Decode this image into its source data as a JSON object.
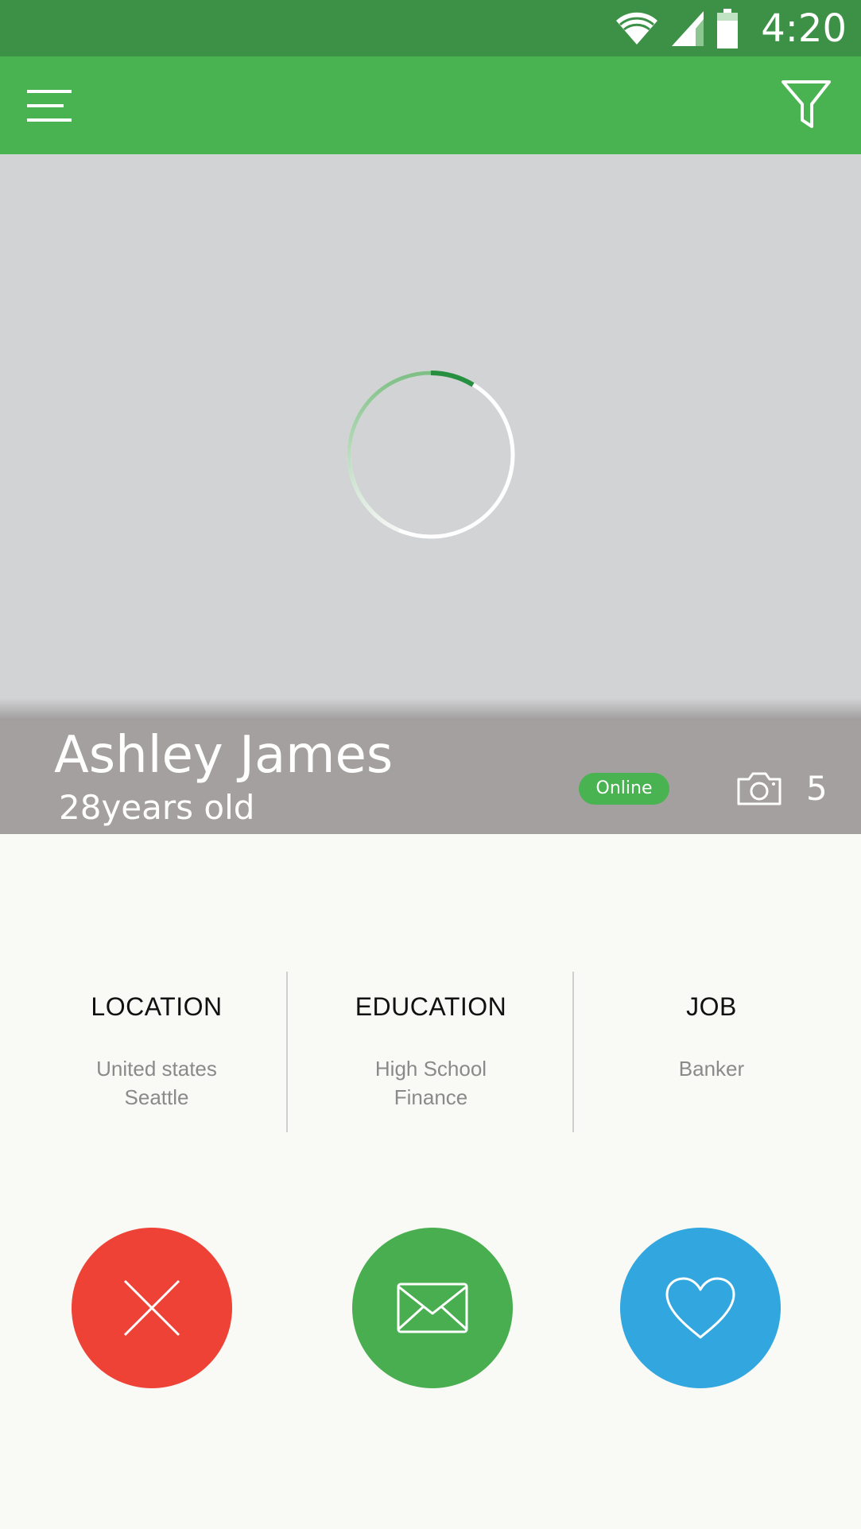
{
  "status_bar": {
    "time": "4:20",
    "icons": [
      "wifi-icon",
      "signal-icon",
      "battery-icon"
    ]
  },
  "app_bar": {
    "icons": [
      "menu-icon",
      "filter-icon"
    ]
  },
  "photo": {
    "state": "loading",
    "spinner_icon": "loading-spinner-icon"
  },
  "profile": {
    "name": "Ashley James",
    "age": "28years old",
    "status": "Online",
    "photo_count": "5",
    "camera_icon": "camera-icon"
  },
  "info": {
    "location": {
      "title": "LOCATION",
      "line1": "United states",
      "line2": "Seattle"
    },
    "education": {
      "title": "EDUCATION",
      "line1": "High School",
      "line2": "Finance"
    },
    "job": {
      "title": "JOB",
      "line1": "Banker"
    }
  },
  "actions": {
    "reject_icon": "close-icon",
    "message_icon": "envelope-icon",
    "like_icon": "heart-icon"
  },
  "colors": {
    "status_bar": "#3c9147",
    "app_bar": "#4ab351",
    "photo_placeholder": "#d2d3d5",
    "profile_strip": "#a4a09f",
    "online_badge": "#4ab351",
    "reject": "#ef4236",
    "message": "#49ae50",
    "like": "#32a6df",
    "background": "#f9f9f6"
  }
}
